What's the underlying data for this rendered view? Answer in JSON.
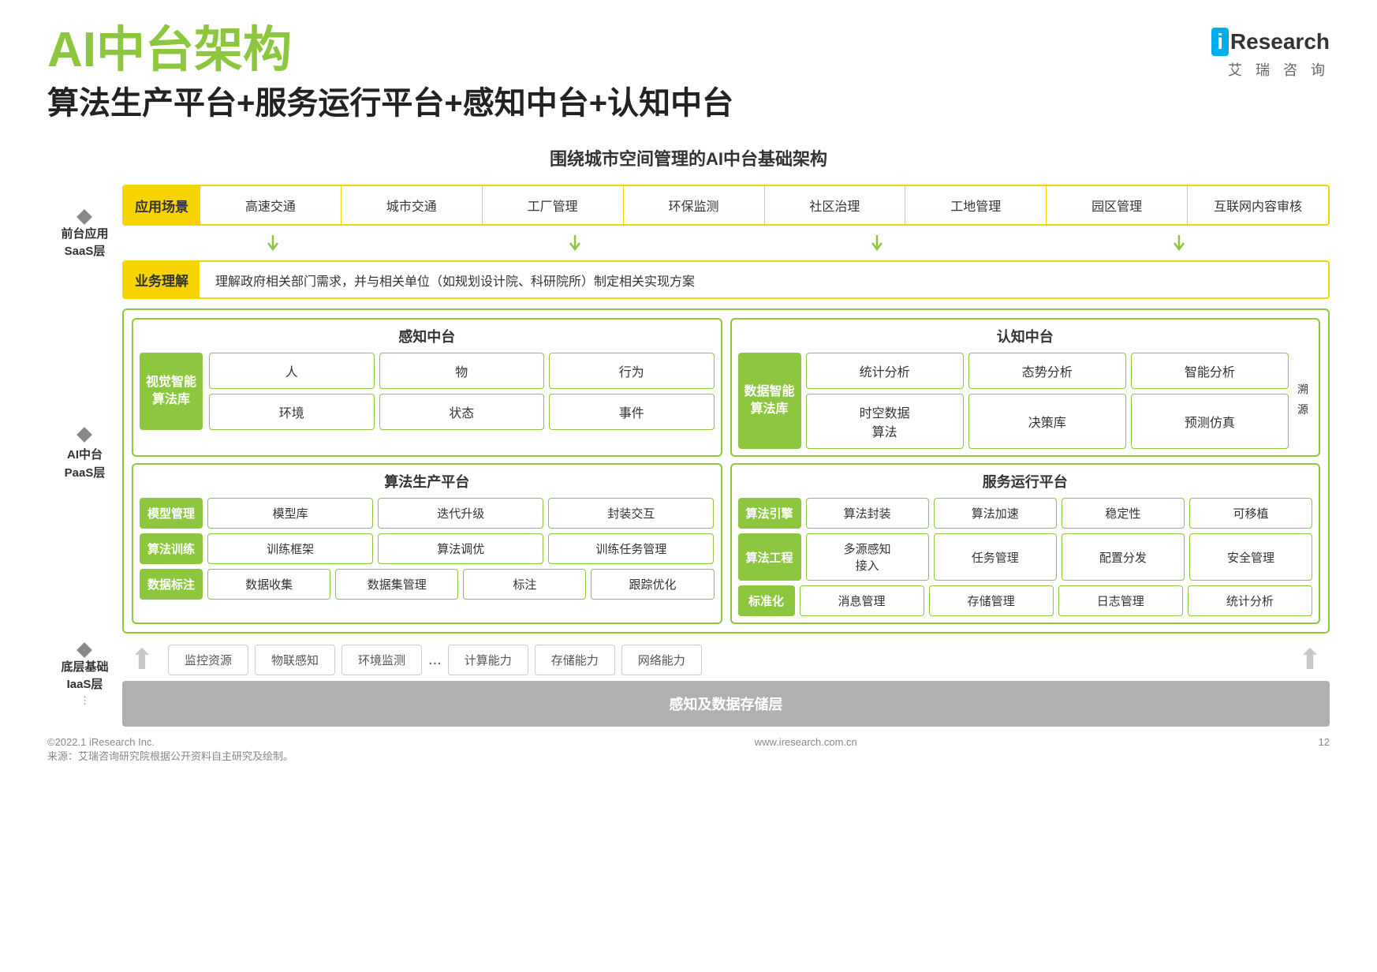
{
  "page": {
    "main_title": "AI中台架构",
    "subtitle": "算法生产平台+服务运行平台+感知中台+认知中台",
    "diagram_title": "围绕城市空间管理的AI中台基础架构",
    "logo": {
      "i": "i",
      "research": "Research",
      "cn": "艾  瑞  咨  询"
    },
    "footer": {
      "source": "来源：艾瑞咨询研究院根据公开资料自主研究及绘制。",
      "copyright": "©2022.1 iResearch Inc.",
      "website": "www.iresearch.com.cn",
      "page_num": "12"
    }
  },
  "saas": {
    "app_scene_label": "应用场景",
    "scenes": [
      "高速交通",
      "城市交通",
      "工厂管理",
      "环保监测",
      "社区治理",
      "工地管理",
      "园区管理",
      "互联网内容审核"
    ],
    "biz_label": "业务理解",
    "biz_text": "理解政府相关部门需求，并与相关单位（如规划设计院、科研院所）制定相关实现方案"
  },
  "left_labels": {
    "front_app": "前台应用",
    "saas": "SaaS层",
    "ai_paas": "AI中台",
    "paas": "PaaS层",
    "base": "底层基础",
    "iaas": "IaaS层"
  },
  "perception": {
    "title": "感知中台",
    "algo_lib_label": "视觉智能\n算法库",
    "items_row1": [
      "人",
      "物",
      "行为"
    ],
    "items_row2": [
      "环境",
      "状态",
      "事件"
    ]
  },
  "cognition": {
    "title": "认知中台",
    "algo_lib_label": "数据智能\n算法库",
    "items_row1": [
      "统计分析",
      "态势分析",
      "智能分析"
    ],
    "items_row2": [
      "时空数据\n算法",
      "决策库",
      "预测仿真"
    ],
    "extra": "溯\n源"
  },
  "algo_platform": {
    "title": "算法生产平台",
    "rows": [
      {
        "label": "模型管理",
        "items": [
          "模型库",
          "迭代升级",
          "封装交互"
        ]
      },
      {
        "label": "算法训练",
        "items": [
          "训练框架",
          "算法调优",
          "训练任务管理"
        ]
      },
      {
        "label": "数据标注",
        "items": [
          "数据收集",
          "数据集管理",
          "标注",
          "跟踪优化"
        ]
      }
    ]
  },
  "service_platform": {
    "title": "服务运行平台",
    "rows": [
      {
        "label": "算法引擎",
        "items": [
          "算法封装",
          "算法加速",
          "稳定性",
          "可移植"
        ]
      },
      {
        "label": "算法工程",
        "items": [
          "多源感知\n接入",
          "任务管理",
          "配置分发",
          "安全管理"
        ]
      },
      {
        "label": "标准化",
        "items": [
          "消息管理",
          "存储管理",
          "日志管理",
          "统计分析"
        ]
      }
    ]
  },
  "iaas": {
    "infra_items": [
      "监控资源",
      "物联感知",
      "环境监测"
    ],
    "dots": "...",
    "compute_items": [
      "计算能力",
      "存储能力",
      "网络能力"
    ],
    "storage_label": "感知及数据存储层"
  }
}
